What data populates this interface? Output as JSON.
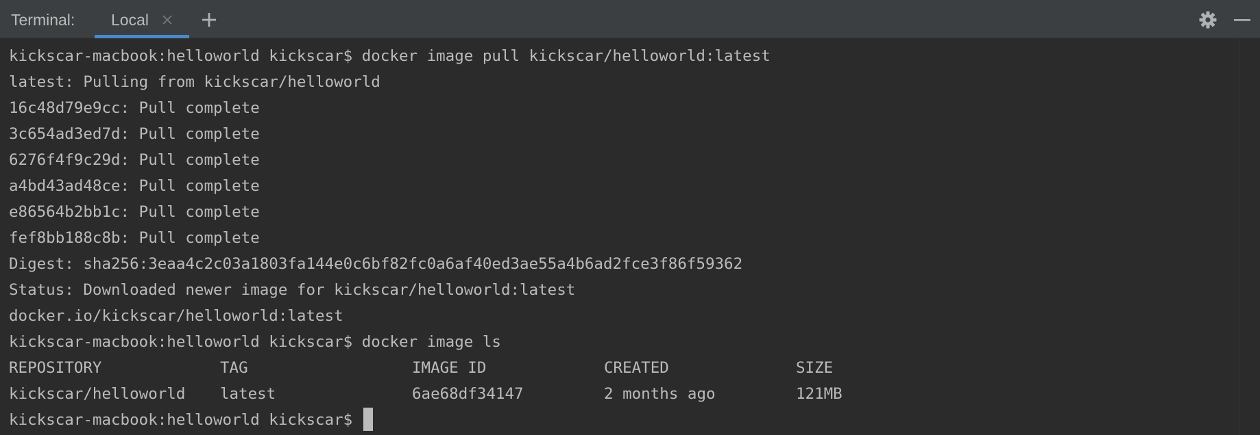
{
  "header": {
    "title": "Terminal:",
    "tab_label": "Local",
    "close_icon": "close-icon",
    "add_icon": "plus-icon",
    "settings_icon": "gear-icon",
    "minimize_icon": "minimize-icon"
  },
  "terminal": {
    "lines": [
      "kickscar-macbook:helloworld kickscar$ docker image pull kickscar/helloworld:latest",
      "latest: Pulling from kickscar/helloworld",
      "16c48d79e9cc: Pull complete",
      "3c654ad3ed7d: Pull complete",
      "6276f4f9c29d: Pull complete",
      "a4bd43ad48ce: Pull complete",
      "e86564b2bb1c: Pull complete",
      "fef8bb188c8b: Pull complete",
      "Digest: sha256:3eaa4c2c03a1803fa144e0c6bf82fc0a6af40ed3ae55a4b6ad2fce3f86f59362",
      "Status: Downloaded newer image for kickscar/helloworld:latest",
      "docker.io/kickscar/helloworld:latest",
      "kickscar-macbook:helloworld kickscar$ docker image ls"
    ],
    "table": {
      "headers": [
        "REPOSITORY",
        "TAG",
        "IMAGE ID",
        "CREATED",
        "SIZE"
      ],
      "rows": [
        [
          "kickscar/helloworld",
          "latest",
          "6ae68df34147",
          "2 months ago",
          "121MB"
        ]
      ]
    },
    "prompt": "kickscar-macbook:helloworld kickscar$ "
  },
  "colors": {
    "background": "#2b2b2b",
    "header": "#3c3f41",
    "text": "#bbbbbb",
    "active_tab_underline": "#4a88c7"
  }
}
